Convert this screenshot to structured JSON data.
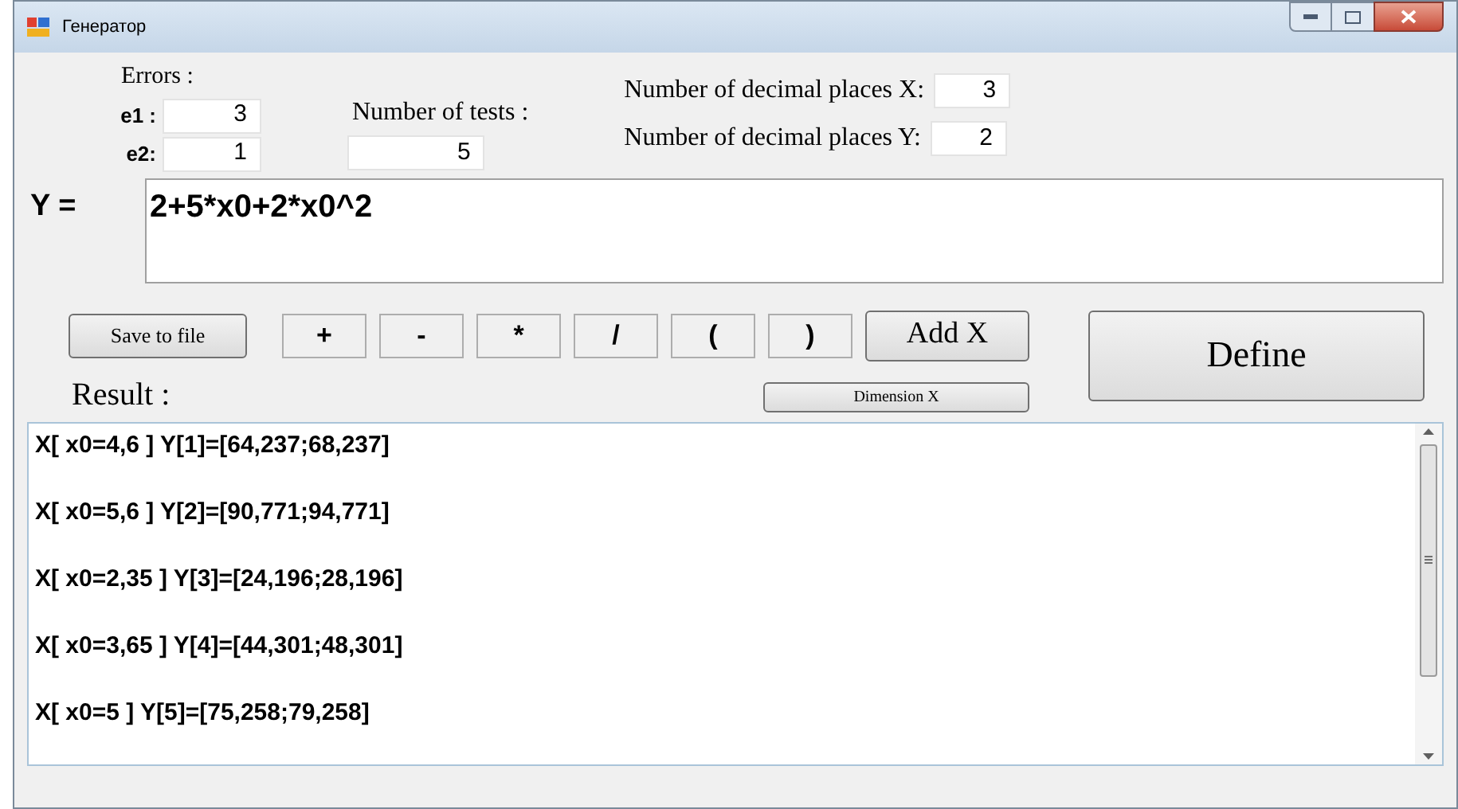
{
  "window": {
    "title": "Генератор"
  },
  "errors": {
    "label": "Errors :",
    "fields": [
      {
        "label": "e1 :",
        "value": "3"
      },
      {
        "label": "e2:",
        "value": "1"
      }
    ]
  },
  "tests": {
    "label": "Number of tests :",
    "value": "5"
  },
  "decimals": [
    {
      "label": "Number of decimal places X:",
      "value": "3"
    },
    {
      "label": "Number of decimal places Y:",
      "value": "2"
    }
  ],
  "formula": {
    "label": "Y =",
    "value": "2+5*x0+2*x0^2"
  },
  "buttons": {
    "save": "Save to file",
    "operators": [
      "+",
      "-",
      "*",
      "/",
      "(",
      ")"
    ],
    "add_x": "Add X",
    "dimension_x": "Dimension X",
    "define": "Define"
  },
  "result": {
    "label": "Result :",
    "lines": [
      "X[ x0=4,6 ] Y[1]=[64,237;68,237]",
      "X[ x0=5,6 ] Y[2]=[90,771;94,771]",
      "X[ x0=2,35 ] Y[3]=[24,196;28,196]",
      "X[ x0=3,65 ] Y[4]=[44,301;48,301]",
      "X[ x0=5 ] Y[5]=[75,258;79,258]"
    ]
  }
}
